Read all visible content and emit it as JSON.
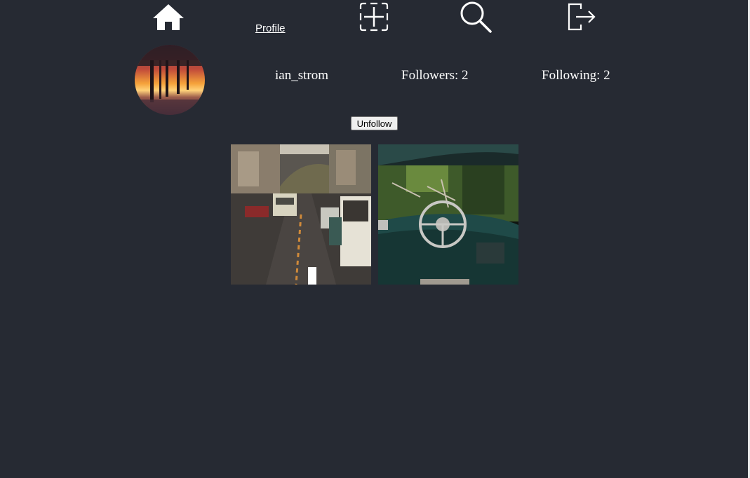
{
  "nav": {
    "home_icon": "home-icon",
    "profile_label": "Profile",
    "create_icon": "add-post-icon",
    "search_icon": "search-icon",
    "logout_icon": "logout-icon"
  },
  "profile": {
    "username": "ian_strom",
    "followers_text": "Followers: 2",
    "following_text": "Following: 2",
    "unfollow_label": "Unfollow"
  },
  "posts": [
    {
      "description": "city street with traffic"
    },
    {
      "description": "vintage car interior with steering wheel"
    }
  ],
  "colors": {
    "background": "#262a33",
    "text": "#ffffff"
  }
}
